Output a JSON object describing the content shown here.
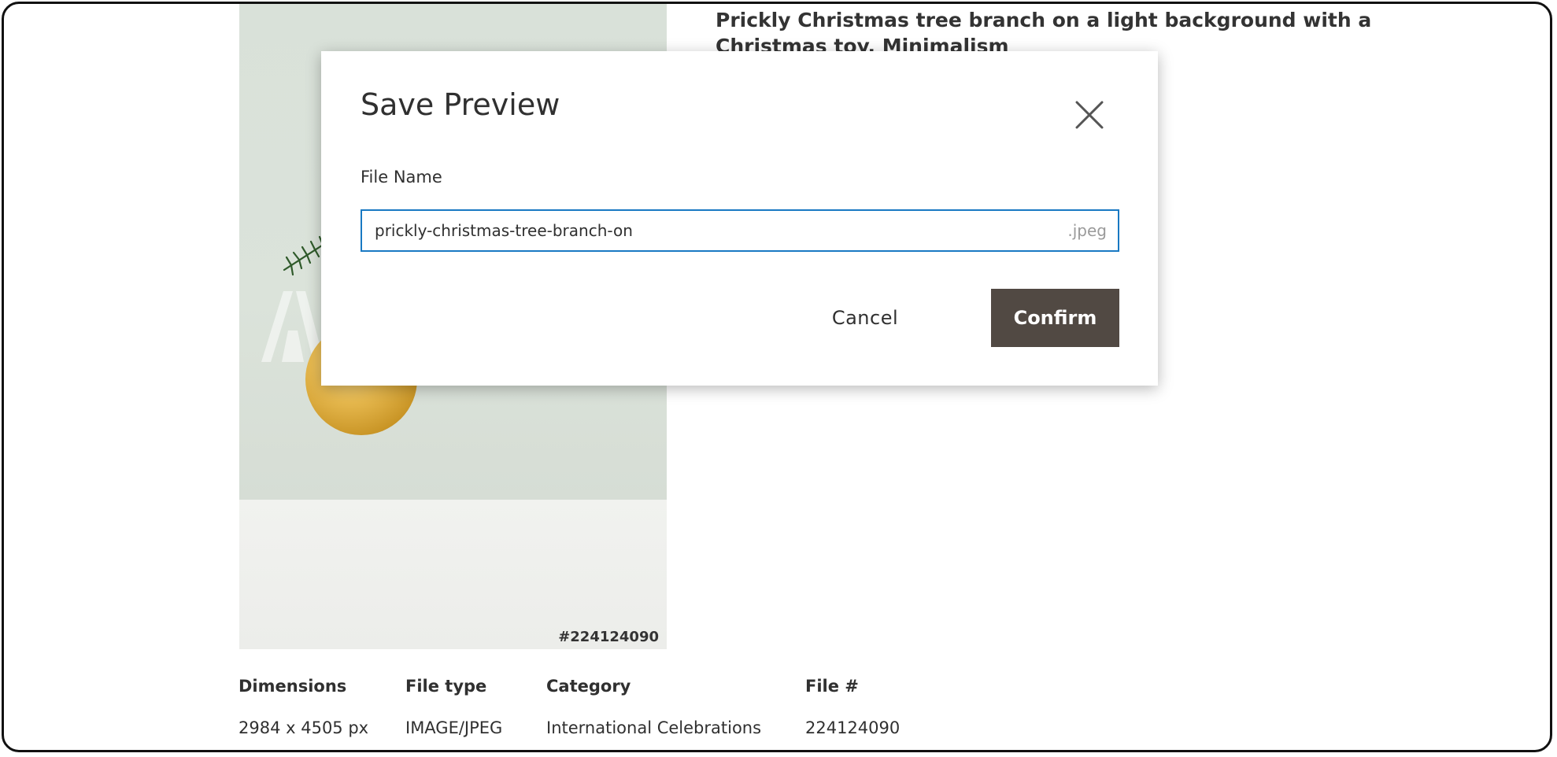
{
  "asset": {
    "title": "Prickly Christmas tree branch on a light background with a Christmas toy. Minimalism",
    "file_id_overlay": "#224124090"
  },
  "details": {
    "dimensions": {
      "label": "Dimensions",
      "value": "2984 x 4505 px"
    },
    "file_type": {
      "label": "File type",
      "value": "IMAGE/JPEG"
    },
    "category": {
      "label": "Category",
      "value": "International Celebrations"
    },
    "file_number": {
      "label": "File #",
      "value": "224124090"
    }
  },
  "modal": {
    "title": "Save Preview",
    "field_label": "File Name",
    "file_name_value": "prickly-christmas-tree-branch-on",
    "extension": ".jpeg",
    "cancel_label": "Cancel",
    "confirm_label": "Confirm"
  },
  "colors": {
    "confirm_bg": "#514943",
    "input_focus": "#1979c3"
  },
  "icons": {
    "close": "close-icon"
  }
}
